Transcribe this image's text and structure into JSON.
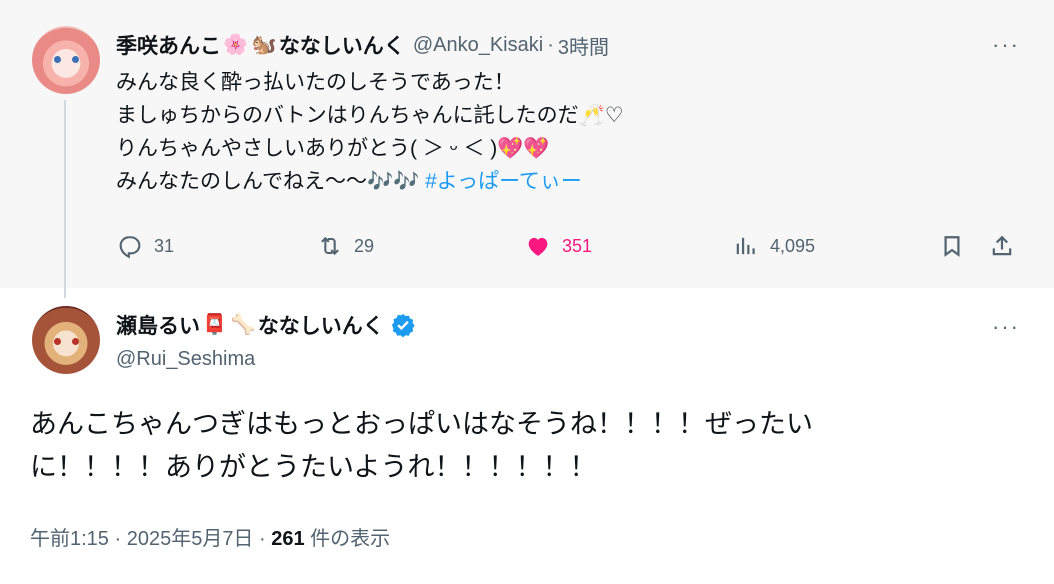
{
  "parent": {
    "display_name": "季咲あんこ",
    "name_suffix": "ななしいんく",
    "emojis": [
      "🌸",
      "🐿️"
    ],
    "handle": "@Anko_Kisaki",
    "separator": "·",
    "time": "3時間",
    "more": "···",
    "lines": [
      "みんな良く酔っ払いたのしそうであった！",
      "ましゅちからのバトンはりんちゃんに託したのだ🥂♡",
      "りんちゃんやさしいありがとう( ＞ ᵕ ＜ )💖💖",
      "みんなたのしんでねえ〜〜🎶🎶"
    ],
    "hashtag": "#よっぱーてぃー",
    "actions": {
      "replies": "31",
      "reposts": "29",
      "likes": "351",
      "views": "4,095"
    },
    "icons": [
      "reply-icon",
      "repost-icon",
      "heart-icon",
      "views-icon",
      "bookmark-icon",
      "share-icon"
    ],
    "like_color": "#f91880"
  },
  "main": {
    "display_name": "瀬島るい",
    "name_suffix": "ななしいんく",
    "emojis": [
      "📮",
      "🦴"
    ],
    "verified_icon": "verified-badge-icon",
    "verified_color": "#1d9bf0",
    "handle": "@Rui_Seshima",
    "more": "···",
    "lines": [
      "あんこちゃんつぎはもっとおっぱいはなそうね！！！！ぜったい",
      "に！！！！ありがとうたいようれ！！！！！！"
    ],
    "timestamp": "午前1:15 · 2025年5月7日 · ",
    "views_count": "261",
    "views_label": " 件の表示"
  }
}
